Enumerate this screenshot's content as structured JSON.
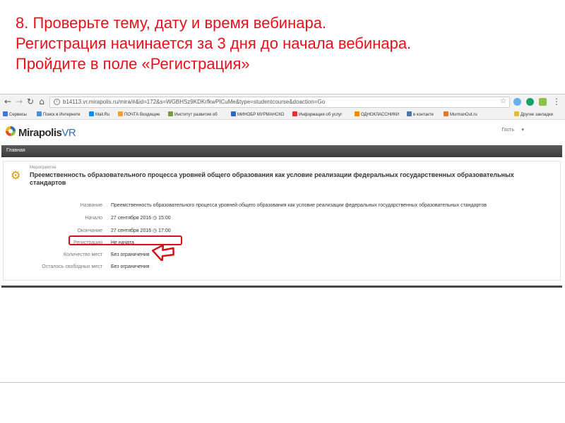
{
  "slide": {
    "title_lines": [
      "8. Проверьте тему,  дату и время  вебинара.",
      "Регистрация начинается за 3 дня до начала вебинара.",
      "Пройдите в поле «Регистрация»"
    ]
  },
  "browser": {
    "url": "b14113.vr.mirapolis.ru/mira/#&id=172&s=WGBHSz9KDKrfkwPICuMe&type=studentcourse&doaction=Go",
    "bookmarks": [
      {
        "label": "Сервисы",
        "color": "#3c78d8"
      },
      {
        "label": "Поиск в Интернете",
        "color": "#4a90d9"
      },
      {
        "label": "Mail.Ru",
        "color": "#168de2"
      },
      {
        "label": "ПОЧТА Входящие",
        "color": "#f0a030"
      },
      {
        "label": "Институт развития об",
        "color": "#7b9c3a"
      },
      {
        "label": "МИНОБР МУРМАНСКО",
        "color": "#2a6ac4"
      },
      {
        "label": "Информация об услуг",
        "color": "#d33"
      },
      {
        "label": "ОДНОКЛАССНИКИ",
        "color": "#f08a00"
      },
      {
        "label": "в контакте",
        "color": "#4a76a8"
      },
      {
        "label": "MurmanOut.ru",
        "color": "#e0782c"
      },
      {
        "label": "Другие закладки",
        "color": "#e8b74a"
      }
    ]
  },
  "app": {
    "brand_main": "Mirapolis",
    "brand_suffix": "VR",
    "user_label": "Гость",
    "menu_item": "Главная"
  },
  "event": {
    "kind": "Мероприятие",
    "title": "Преемственность образовательного процесса уровней общего образования как условие реализации федеральных государственных образовательных стандартов",
    "properties": [
      {
        "label": "Название",
        "value": "Преемственность образовательного процесса уровней общего образования как условие реализации федеральных государственных образовательных стандартов"
      },
      {
        "label": "Начало",
        "value": "27 сентября 2016   ◷ 15:00"
      },
      {
        "label": "Окончание",
        "value": "27 сентября 2016   ◷ 17:00"
      },
      {
        "label": "Регистрация",
        "value": "Не начата"
      },
      {
        "label": "Количество мест",
        "value": "Без ограничения"
      },
      {
        "label": "Осталось свободных мест",
        "value": "Без ограничения"
      }
    ]
  },
  "colors": {
    "title_red": "#e8111b",
    "highlight_red": "#d4101a",
    "menubar": "#444444"
  },
  "icons": [
    "back-icon",
    "forward-icon",
    "reload-icon",
    "home-icon",
    "star-icon",
    "apps-icon",
    "gear-icon",
    "pointer-arrow-icon"
  ]
}
